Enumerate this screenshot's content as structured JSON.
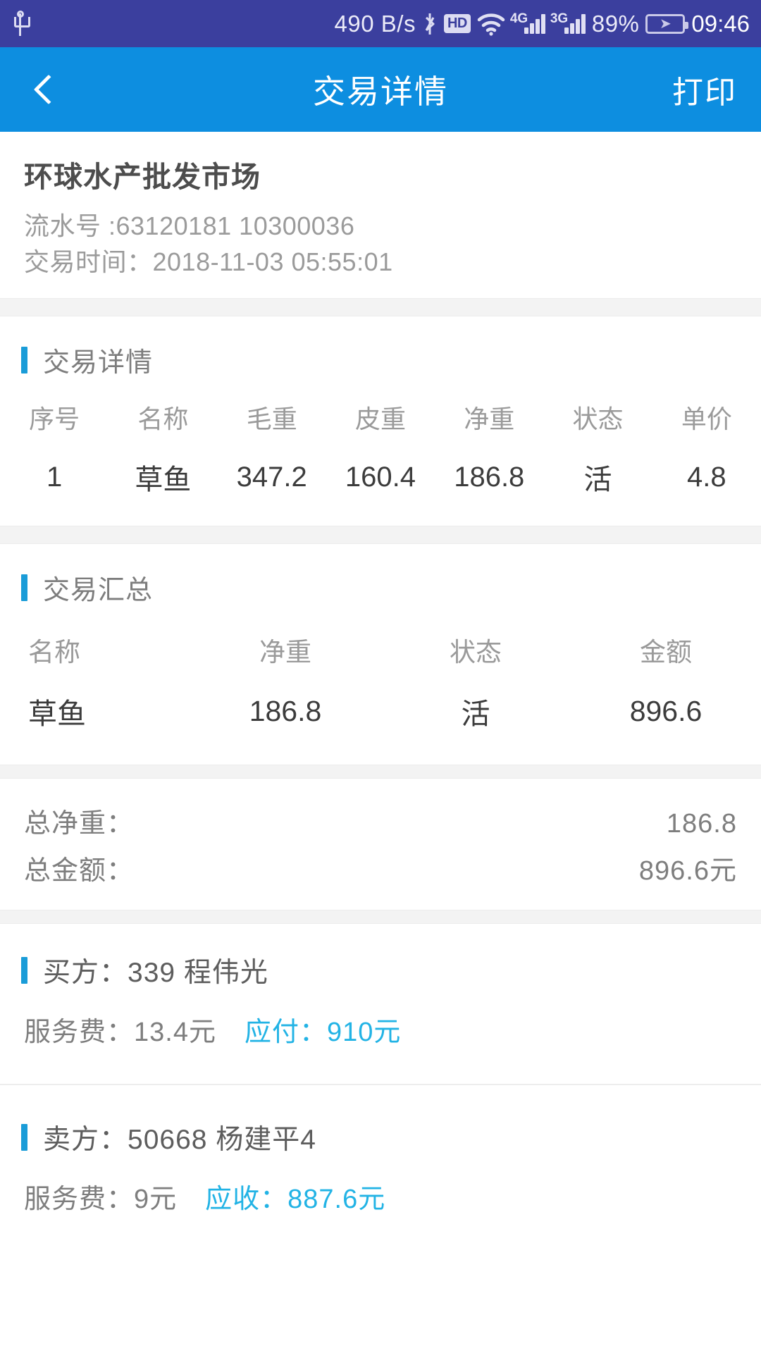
{
  "status_bar": {
    "usb_icon": "usb-icon",
    "network_speed": "490 B/s",
    "bluetooth_icon": "bluetooth-icon",
    "hd_badge": "HD",
    "wifi_icon": "wifi-icon",
    "sim1_label": "4G",
    "sim2_label": "3G",
    "battery_percent": "89%",
    "battery_icon": "battery-charging-icon",
    "clock": "09:46"
  },
  "app_bar": {
    "back_icon": "chevron-left-icon",
    "title": "交易详情",
    "print_label": "打印"
  },
  "market": {
    "name": "环球水产批发市场",
    "serial_line": "流水号 :63120181 10300036",
    "time_line": "交易时间：2018-11-03 05:55:01"
  },
  "detail_section": {
    "title": "交易详情",
    "columns": [
      "序号",
      "名称",
      "毛重",
      "皮重",
      "净重",
      "状态",
      "单价"
    ],
    "rows": [
      [
        "1",
        "草鱼",
        "347.2",
        "160.4",
        "186.8",
        "活",
        "4.8"
      ]
    ]
  },
  "summary_section": {
    "title": "交易汇总",
    "columns": [
      "名称",
      "净重",
      "状态",
      "金额"
    ],
    "rows": [
      [
        "草鱼",
        "186.8",
        "活",
        "896.6"
      ]
    ]
  },
  "totals": {
    "net_weight_label": "总净重：",
    "net_weight_value": "186.8",
    "amount_label": "总金额：",
    "amount_value": "896.6元"
  },
  "buyer": {
    "title": "买方：339 程伟光",
    "fee_label": "服务费：13.4元",
    "payable_label": "应付：910元"
  },
  "seller": {
    "title": "卖方：50668 杨建平4",
    "fee_label": "服务费：9元",
    "receivable_label": "应收：887.6元"
  },
  "colors": {
    "status_bar_bg": "#3b3f9e",
    "app_bar_bg": "#0d8ee0",
    "accent_bar": "#1a9cd8",
    "highlight": "#22b3e5",
    "page_bg": "#f3f3f3"
  }
}
